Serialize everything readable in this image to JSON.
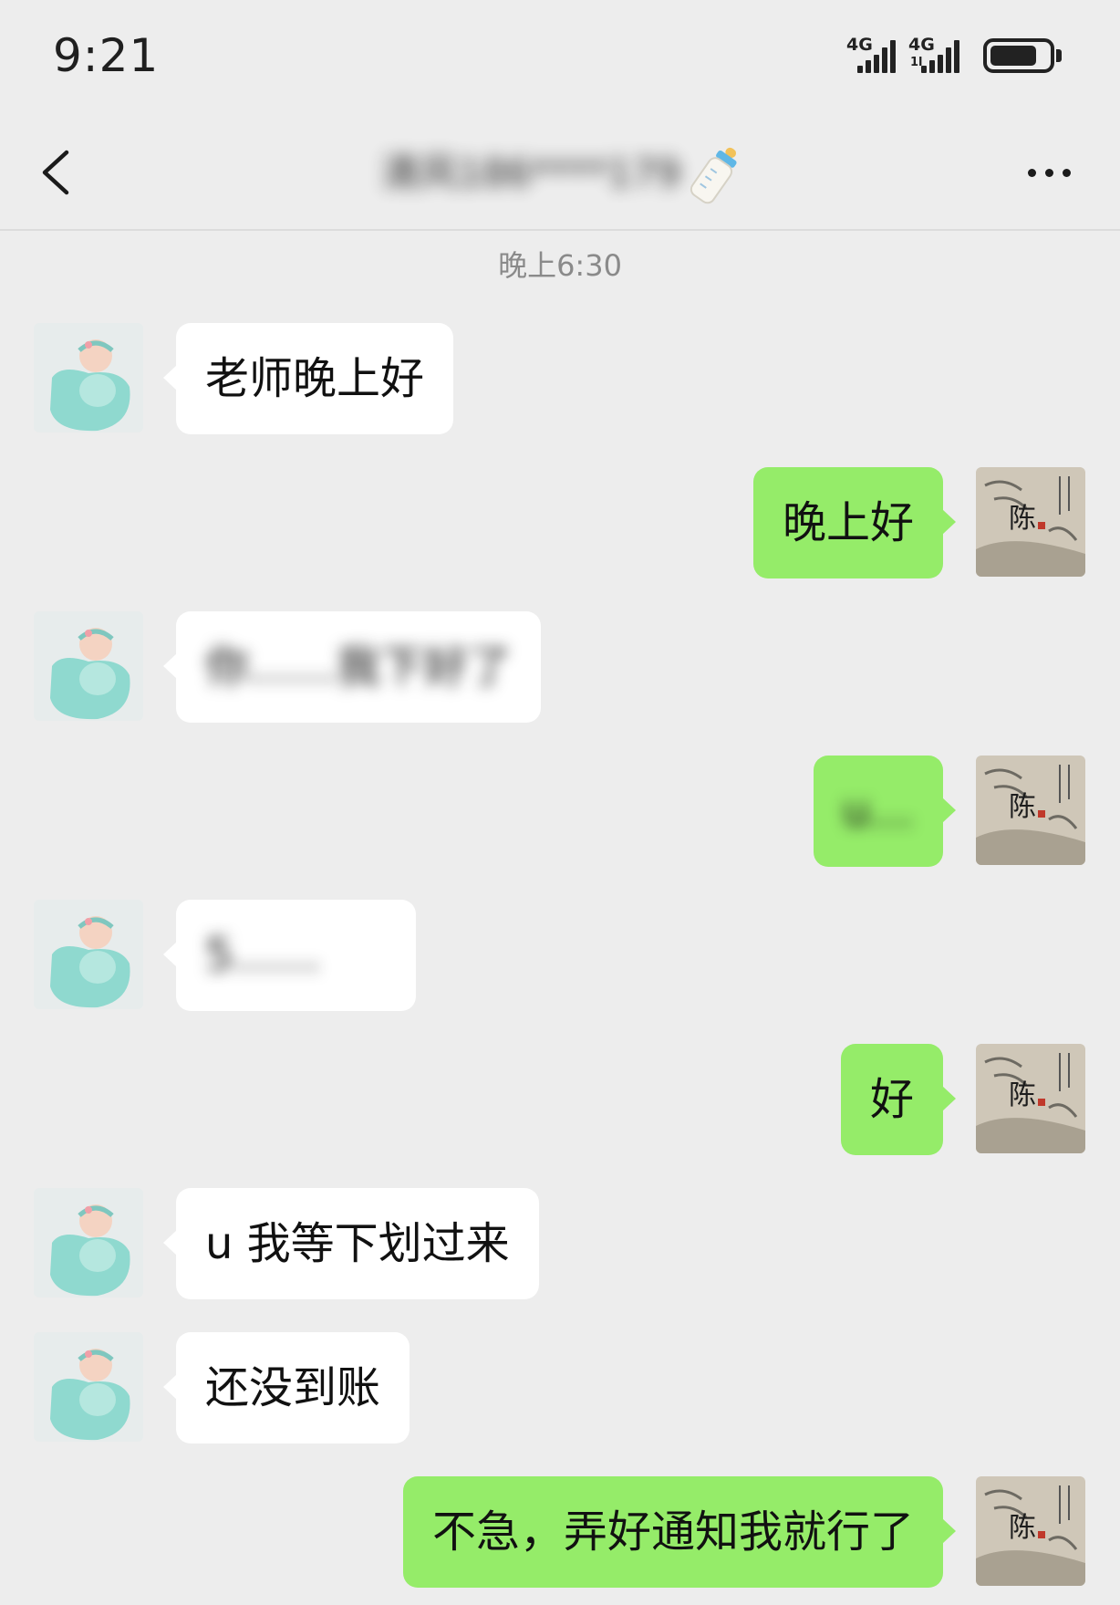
{
  "status_bar": {
    "time": "9:21",
    "signal1_label": "4G",
    "signal2_label": "4G",
    "signal2_sub": "1l",
    "battery_fraction": 0.8
  },
  "nav": {
    "title": "清风186****179",
    "title_emoji": "baby-bottle-icon"
  },
  "chat": {
    "timestamp": "晚上6:30",
    "messages": [
      {
        "side": "left",
        "text": "老师晚上好"
      },
      {
        "side": "right",
        "text": "晚上好"
      },
      {
        "side": "left",
        "text": "你……我下好了"
      },
      {
        "side": "right",
        "text": "u…"
      },
      {
        "side": "left",
        "text": "5……"
      },
      {
        "side": "right",
        "text": "好"
      },
      {
        "side": "left",
        "text": "u 我等下划过来"
      },
      {
        "side": "left",
        "text": "还没到账"
      },
      {
        "side": "right",
        "text": "不急，弄好通知我就行了"
      }
    ]
  },
  "colors": {
    "background": "#ededed",
    "bubble_self": "#95ec69",
    "bubble_other": "#ffffff"
  }
}
